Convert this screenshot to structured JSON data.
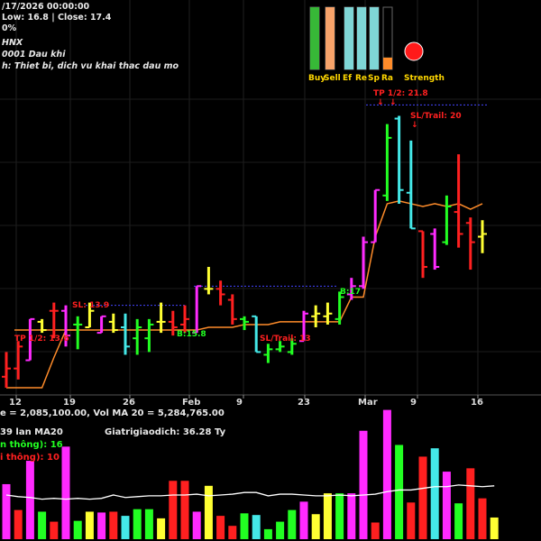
{
  "header": {
    "line1": "/17/2026 00:00:00",
    "line2": "Low: 16.8  | Close: 17.4",
    "line3": "0%",
    "line4": "HNX",
    "line5": "0001 Dau khi",
    "line6": "h: Thiet bi, dich vu khai thac dau mo"
  },
  "strength_panel": {
    "labels": [
      "Buy",
      "Sell",
      "Ef",
      "Re",
      "Sp",
      "Ra"
    ],
    "values": [
      1.0,
      1.0,
      1.0,
      1.0,
      1.0,
      0.19
    ],
    "colors": [
      "#37b837",
      "#f7a36a",
      "#7fd6d6",
      "#7fd6d6",
      "#7fd6d6",
      "#7fd6d6"
    ],
    "indicator_color": "#ff1a1a",
    "strength_label": "Strength"
  },
  "annotations": {
    "tp1": "TP 1/2: 21.8",
    "sl_trail1": "SL/Trail: 20",
    "sl1": "SL: 13.9",
    "tp2": "TP 1/2: 13.6",
    "b1": "B:15.8",
    "sl_trail2": "SL/Trail: 13",
    "b2": "B:17"
  },
  "volume_info": {
    "line1": "e = 2,085,100.00, Vol MA 20 = 5,284,765.00",
    "line2": "39 lan MA20",
    "line2b": "Giatrigiaodich: 36.28 Ty",
    "line3": "n thông): 16",
    "line4": "i thông): 10"
  },
  "chart_data": {
    "type": "candlestick",
    "x_ticks": [
      "12",
      "19",
      "26",
      "Feb",
      "9",
      "23",
      "Mar",
      "9",
      "16"
    ],
    "ylim": [
      11.5,
      22.5
    ],
    "candles": [
      {
        "o": 11.9,
        "h": 12.8,
        "l": 11.5,
        "c": 12.2,
        "color": "#ff2020"
      },
      {
        "o": 12.2,
        "h": 13.2,
        "l": 11.8,
        "c": 13.0,
        "color": "#ff2020"
      },
      {
        "o": 12.5,
        "h": 14.0,
        "l": 12.5,
        "c": 14.0,
        "color": "#ff2aff"
      },
      {
        "o": 13.9,
        "h": 14.0,
        "l": 13.5,
        "c": 13.6,
        "color": "#ffff33"
      },
      {
        "o": 14.3,
        "h": 14.6,
        "l": 13.3,
        "c": 14.3,
        "color": "#ff2020"
      },
      {
        "o": 14.3,
        "h": 14.5,
        "l": 13.0,
        "c": 13.4,
        "color": "#ff2aff"
      },
      {
        "o": 13.8,
        "h": 14.1,
        "l": 12.9,
        "c": 13.8,
        "color": "#22ff22"
      },
      {
        "o": 13.7,
        "h": 14.6,
        "l": 13.7,
        "c": 14.3,
        "color": "#ffff33"
      },
      {
        "o": 13.5,
        "h": 14.1,
        "l": 13.5,
        "c": 14.1,
        "color": "#ff2aff"
      },
      {
        "o": 13.9,
        "h": 14.2,
        "l": 13.5,
        "c": 13.6,
        "color": "#ffff33"
      },
      {
        "o": 13.7,
        "h": 14.2,
        "l": 12.7,
        "c": 13.0,
        "color": "#44e8e8"
      },
      {
        "o": 13.3,
        "h": 14.0,
        "l": 12.7,
        "c": 13.7,
        "color": "#22ff22"
      },
      {
        "o": 13.3,
        "h": 14.0,
        "l": 12.8,
        "c": 13.8,
        "color": "#22ff22"
      },
      {
        "o": 13.9,
        "h": 14.6,
        "l": 13.5,
        "c": 13.9,
        "color": "#ffff33"
      },
      {
        "o": 13.9,
        "h": 14.3,
        "l": 13.4,
        "c": 13.7,
        "color": "#ff2020"
      },
      {
        "o": 13.8,
        "h": 14.5,
        "l": 13.5,
        "c": 14.0,
        "color": "#ff2020"
      },
      {
        "o": 13.5,
        "h": 15.2,
        "l": 13.5,
        "c": 15.2,
        "color": "#ff2aff"
      },
      {
        "o": 15.1,
        "h": 15.9,
        "l": 14.9,
        "c": 15.1,
        "color": "#ffff33"
      },
      {
        "o": 15.1,
        "h": 15.4,
        "l": 14.5,
        "c": 14.9,
        "color": "#ff2020"
      },
      {
        "o": 14.7,
        "h": 14.9,
        "l": 13.8,
        "c": 14.0,
        "color": "#ff2020"
      },
      {
        "o": 14.0,
        "h": 14.1,
        "l": 13.6,
        "c": 13.9,
        "color": "#22ff22"
      },
      {
        "o": 14.1,
        "h": 14.1,
        "l": 12.8,
        "c": 12.8,
        "color": "#44e8e8"
      },
      {
        "o": 12.7,
        "h": 13.1,
        "l": 12.4,
        "c": 12.9,
        "color": "#22ff22"
      },
      {
        "o": 12.9,
        "h": 13.2,
        "l": 12.8,
        "c": 13.0,
        "color": "#22ff22"
      },
      {
        "o": 12.8,
        "h": 13.3,
        "l": 12.7,
        "c": 13.1,
        "color": "#22ff22"
      },
      {
        "o": 13.2,
        "h": 14.3,
        "l": 13.2,
        "c": 14.2,
        "color": "#ff2aff"
      },
      {
        "o": 14.1,
        "h": 14.5,
        "l": 13.7,
        "c": 14.2,
        "color": "#ffff33"
      },
      {
        "o": 14.1,
        "h": 14.6,
        "l": 13.8,
        "c": 14.2,
        "color": "#ffff33"
      },
      {
        "o": 14.0,
        "h": 15.0,
        "l": 13.8,
        "c": 14.8,
        "color": "#22ff22"
      },
      {
        "o": 14.9,
        "h": 15.5,
        "l": 14.7,
        "c": 15.2,
        "color": "#ff2aff"
      },
      {
        "o": 15.2,
        "h": 17.0,
        "l": 15.1,
        "c": 16.8,
        "color": "#ff2aff"
      },
      {
        "o": 16.8,
        "h": 18.7,
        "l": 16.8,
        "c": 18.7,
        "color": "#ff2aff"
      },
      {
        "o": 18.5,
        "h": 21.1,
        "l": 18.3,
        "c": 20.6,
        "color": "#22ff22"
      },
      {
        "o": 21.3,
        "h": 21.4,
        "l": 18.2,
        "c": 18.7,
        "color": "#44e8e8"
      },
      {
        "o": 18.6,
        "h": 20.5,
        "l": 17.3,
        "c": 17.3,
        "color": "#44e8e8"
      },
      {
        "o": 17.2,
        "h": 17.2,
        "l": 15.5,
        "c": 15.9,
        "color": "#ff2020"
      },
      {
        "o": 17.1,
        "h": 17.3,
        "l": 15.8,
        "c": 15.9,
        "color": "#ff2aff"
      },
      {
        "o": 16.8,
        "h": 18.5,
        "l": 16.7,
        "c": 18.1,
        "color": "#22ff22"
      },
      {
        "o": 17.9,
        "h": 20.0,
        "l": 16.6,
        "c": 17.1,
        "color": "#ff2020"
      },
      {
        "o": 17.5,
        "h": 17.7,
        "l": 15.8,
        "c": 16.8,
        "color": "#ff2020"
      },
      {
        "o": 17.0,
        "h": 17.6,
        "l": 16.4,
        "c": 17.1,
        "color": "#ffff33"
      }
    ],
    "trail_stop": [
      11.5,
      11.5,
      11.5,
      11.5,
      12.6,
      13.6,
      13.6,
      13.6,
      13.6,
      13.6,
      13.6,
      13.6,
      13.6,
      13.6,
      13.6,
      13.6,
      13.6,
      13.7,
      13.7,
      13.7,
      13.8,
      13.8,
      13.8,
      13.9,
      13.9,
      13.9,
      13.9,
      13.9,
      13.9,
      14.8,
      14.8,
      17.0,
      18.2,
      18.3,
      18.2,
      18.1,
      18.2,
      18.1,
      18.2,
      18.0,
      18.2
    ],
    "volume": [
      {
        "v": 6.6,
        "color": "#ff2aff"
      },
      {
        "v": 3.5,
        "color": "#ff2020"
      },
      {
        "v": 9.4,
        "color": "#ff2aff"
      },
      {
        "v": 3.3,
        "color": "#22ff22"
      },
      {
        "v": 2.1,
        "color": "#ff2020"
      },
      {
        "v": 11.1,
        "color": "#ff2aff"
      },
      {
        "v": 2.2,
        "color": "#22ff22"
      },
      {
        "v": 3.3,
        "color": "#ffff33"
      },
      {
        "v": 3.2,
        "color": "#ff2aff"
      },
      {
        "v": 3.3,
        "color": "#ff2020"
      },
      {
        "v": 2.8,
        "color": "#44e8e8"
      },
      {
        "v": 3.6,
        "color": "#22ff22"
      },
      {
        "v": 3.6,
        "color": "#22ff22"
      },
      {
        "v": 2.5,
        "color": "#ffff33"
      },
      {
        "v": 7.0,
        "color": "#ff2020"
      },
      {
        "v": 7.0,
        "color": "#ff2020"
      },
      {
        "v": 3.3,
        "color": "#ff2aff"
      },
      {
        "v": 6.4,
        "color": "#ffff33"
      },
      {
        "v": 2.8,
        "color": "#ff2020"
      },
      {
        "v": 1.6,
        "color": "#ff2020"
      },
      {
        "v": 3.1,
        "color": "#22ff22"
      },
      {
        "v": 2.9,
        "color": "#44e8e8"
      },
      {
        "v": 1.2,
        "color": "#22ff22"
      },
      {
        "v": 2.1,
        "color": "#22ff22"
      },
      {
        "v": 3.5,
        "color": "#22ff22"
      },
      {
        "v": 4.5,
        "color": "#ff2aff"
      },
      {
        "v": 3.0,
        "color": "#ffff33"
      },
      {
        "v": 5.5,
        "color": "#ffff33"
      },
      {
        "v": 5.5,
        "color": "#22ff22"
      },
      {
        "v": 5.5,
        "color": "#ff2aff"
      },
      {
        "v": 13.0,
        "color": "#ff2aff"
      },
      {
        "v": 2.0,
        "color": "#ff2020"
      },
      {
        "v": 15.5,
        "color": "#ff2aff"
      },
      {
        "v": 11.3,
        "color": "#22ff22"
      },
      {
        "v": 4.4,
        "color": "#ff2020"
      },
      {
        "v": 9.9,
        "color": "#ff2020"
      },
      {
        "v": 10.9,
        "color": "#44e8e8"
      },
      {
        "v": 8.1,
        "color": "#ff2aff"
      },
      {
        "v": 4.3,
        "color": "#22ff22"
      },
      {
        "v": 8.5,
        "color": "#ff2020"
      },
      {
        "v": 4.9,
        "color": "#ff2020"
      },
      {
        "v": 2.6,
        "color": "#ffff33"
      }
    ],
    "volume_ma": [
      5.3,
      5.1,
      5.0,
      4.8,
      4.9,
      4.8,
      4.9,
      4.8,
      4.9,
      5.3,
      5.0,
      5.1,
      5.2,
      5.2,
      5.3,
      5.3,
      5.4,
      5.2,
      5.3,
      5.4,
      5.6,
      5.6,
      5.2,
      5.4,
      5.4,
      5.3,
      5.2,
      5.2,
      5.3,
      5.2,
      5.3,
      5.4,
      5.7,
      5.9,
      5.9,
      6.1,
      6.3,
      6.3,
      6.5,
      6.4,
      6.3,
      6.4
    ],
    "volume_ylim": [
      0,
      16
    ]
  }
}
